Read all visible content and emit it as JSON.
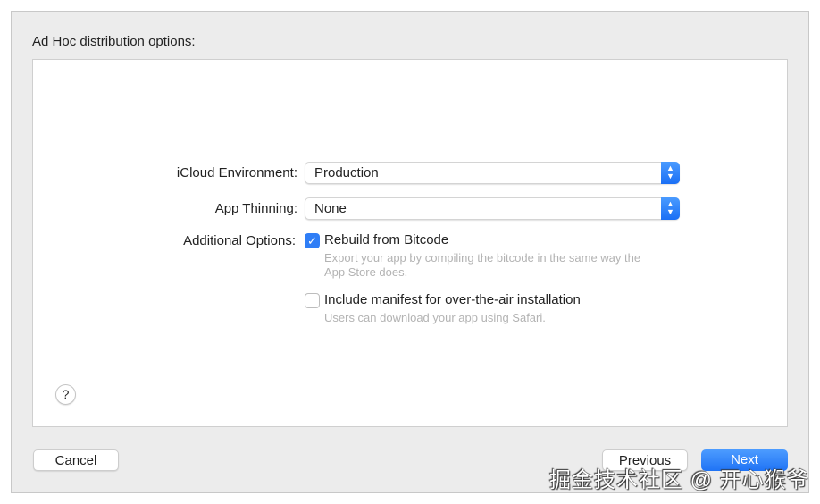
{
  "title": "Ad Hoc distribution options:",
  "fields": {
    "icloud": {
      "label": "iCloud Environment:",
      "value": "Production"
    },
    "thinning": {
      "label": "App Thinning:",
      "value": "None"
    },
    "additional_label": "Additional Options:"
  },
  "options": [
    {
      "label": "Rebuild from Bitcode",
      "checked": true,
      "desc1": "Export your app by compiling the bitcode in the same way the",
      "desc2": "App Store does."
    },
    {
      "label": "Include manifest for over-the-air installation",
      "checked": false,
      "desc1": "Users can download your app using Safari."
    }
  ],
  "help": "?",
  "buttons": {
    "cancel": "Cancel",
    "previous": "Previous",
    "next": "Next"
  },
  "watermark": "掘金技术社区 @ 开心猴爷",
  "icons": {
    "stepper": "⌃⌄",
    "check": "✓"
  }
}
